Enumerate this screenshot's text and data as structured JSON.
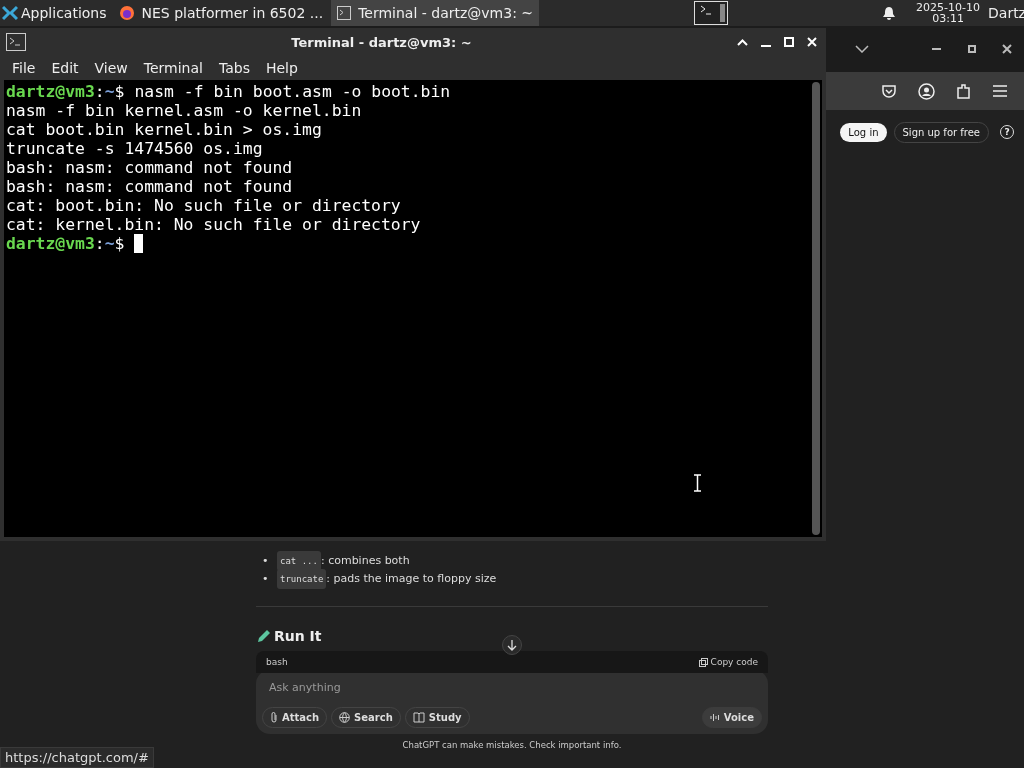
{
  "taskbar": {
    "menu_label": "Applications",
    "tasks": [
      {
        "kind": "browser",
        "label": "NES platformer in 6502 ...",
        "selected": false
      },
      {
        "kind": "terminal",
        "label": "Terminal - dartz@vm3: ~",
        "selected": true
      }
    ],
    "date": "2025-10-10",
    "time": "03:11",
    "user": "Dartz"
  },
  "browser": {
    "login": "Log in",
    "signup": "Sign up for free",
    "help": "?",
    "bullets": [
      {
        "marker": "•",
        "code": "cat ...",
        "text": ": combines both"
      },
      {
        "marker": "•",
        "code": "truncate",
        "text": ": pads the image to floppy size"
      }
    ],
    "heading": "Run It",
    "code_lang": "bash",
    "copy": "Copy code",
    "composer": {
      "placeholder": "Ask anything",
      "buttons": [
        {
          "kind": "attach",
          "label": "Attach"
        },
        {
          "kind": "search",
          "label": "Search"
        },
        {
          "kind": "study",
          "label": "Study"
        }
      ],
      "voice": "Voice"
    },
    "disclaimer": "ChatGPT can make mistakes. Check important info.",
    "status_url": "https://chatgpt.com/#"
  },
  "terminal": {
    "title": "Terminal - dartz@vm3: ~",
    "menu": [
      "File",
      "Edit",
      "View",
      "Terminal",
      "Tabs",
      "Help"
    ],
    "lines": [
      {
        "kind": "prompt",
        "user": "dartz@vm3",
        "sep": ":",
        "path": "~",
        "sigil": "$",
        "text": "nasm -f bin boot.asm -o boot.bin"
      },
      {
        "kind": "output",
        "text": "nasm -f bin kernel.asm -o kernel.bin"
      },
      {
        "kind": "output",
        "text": "cat boot.bin kernel.bin > os.img"
      },
      {
        "kind": "output",
        "text": "truncate -s 1474560 os.img"
      },
      {
        "kind": "output",
        "text": "bash: nasm: command not found"
      },
      {
        "kind": "output",
        "text": "bash: nasm: command not found"
      },
      {
        "kind": "output",
        "text": "cat: boot.bin: No such file or directory"
      },
      {
        "kind": "output",
        "text": "cat: kernel.bin: No such file or directory"
      },
      {
        "kind": "prompt",
        "user": "dartz@vm3",
        "sep": ":",
        "path": "~",
        "sigil": "$",
        "cursor": true
      }
    ]
  }
}
